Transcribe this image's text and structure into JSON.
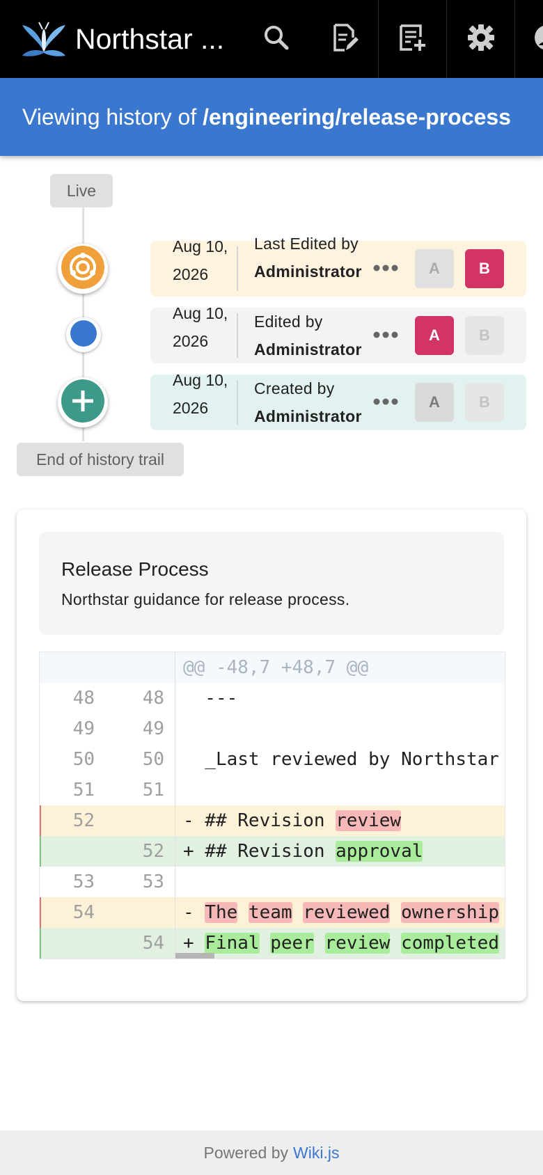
{
  "app": {
    "title": "Northstar ..."
  },
  "toolbar": {
    "icons": [
      "search-icon",
      "edit-page-icon",
      "new-page-icon",
      "settings-icon",
      "account-icon"
    ]
  },
  "banner": {
    "prefix": "Viewing history of",
    "path": "/engineering/release-process"
  },
  "timeline": {
    "start_label": "Live",
    "end_label": "End of history trail",
    "entries": [
      {
        "date": "Aug 10, 2026",
        "action": "Last Edited by",
        "author": "Administrator",
        "icon": "live-icon",
        "a": "A",
        "b": "B"
      },
      {
        "date": "Aug 10, 2026",
        "action": "Edited by",
        "author": "Administrator",
        "icon": "dot-icon",
        "a": "A",
        "b": "B"
      },
      {
        "date": "Aug 10, 2026",
        "action": "Created by",
        "author": "Administrator",
        "icon": "plus-icon",
        "a": "A",
        "b": "B"
      }
    ],
    "menu_icon": "more-horizontal-icon"
  },
  "document": {
    "title": "Release Process",
    "description": "Northstar guidance for release process."
  },
  "diff": {
    "hunk": "@@ -48,7 +48,7 @@",
    "rows": [
      {
        "old": "48",
        "new": "48",
        "text": "  ---"
      },
      {
        "old": "49",
        "new": "49",
        "text": ""
      },
      {
        "old": "50",
        "new": "50",
        "text": "  _Last reviewed by Northstar"
      },
      {
        "old": "51",
        "new": "51",
        "text": ""
      },
      {
        "old": "52",
        "new": "",
        "sign": "-",
        "pre": " ## Revision ",
        "hl": "review"
      },
      {
        "old": "",
        "new": "52",
        "sign": "+",
        "pre": " ## Revision ",
        "hl": "approval"
      },
      {
        "old": "53",
        "new": "53",
        "text": ""
      },
      {
        "old": "54",
        "new": "",
        "sign": "-",
        "words": [
          "The",
          "team",
          "reviewed",
          "ownership"
        ]
      },
      {
        "old": "",
        "new": "54",
        "sign": "+",
        "words": [
          "Final",
          "peer",
          "review",
          "completed"
        ]
      }
    ]
  },
  "footer": {
    "prefix": "Powered by",
    "link": "Wiki.js"
  },
  "colors": {
    "accent": "#3a77cf",
    "live_orange": "#f0a03a",
    "edit_blue": "#3a77cf",
    "create_teal": "#3d9a8a",
    "selected_pink": "#d33466"
  }
}
